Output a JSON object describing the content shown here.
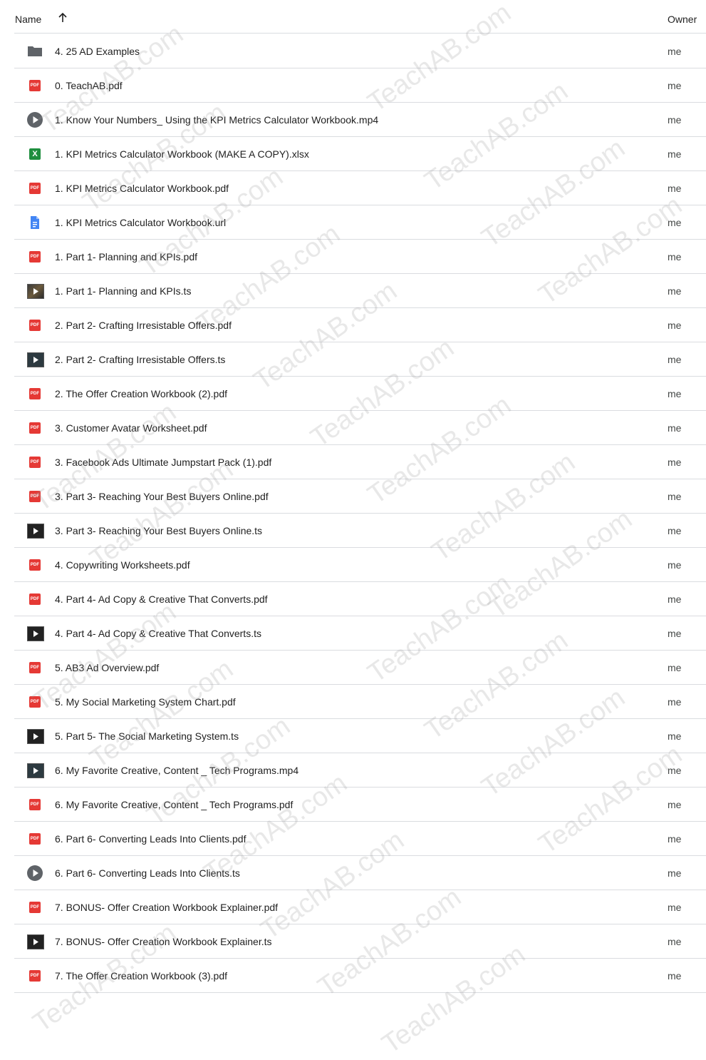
{
  "header": {
    "name_label": "Name",
    "owner_label": "Owner"
  },
  "files": [
    {
      "name": "4. 25 AD Examples",
      "icon": "folder-icon",
      "owner": "me"
    },
    {
      "name": "0. TeachAB.pdf",
      "icon": "pdf-icon",
      "owner": "me"
    },
    {
      "name": "1. Know Your Numbers_ Using the KPI Metrics Calculator Workbook.mp4",
      "icon": "video-icon",
      "owner": "me"
    },
    {
      "name": "1. KPI Metrics Calculator Workbook (MAKE A COPY).xlsx",
      "icon": "spreadsheet-icon",
      "owner": "me"
    },
    {
      "name": "1. KPI Metrics Calculator Workbook.pdf",
      "icon": "pdf-icon",
      "owner": "me"
    },
    {
      "name": "1. KPI Metrics Calculator Workbook.url",
      "icon": "document-icon",
      "owner": "me"
    },
    {
      "name": "1. Part 1- Planning and KPIs.pdf",
      "icon": "pdf-icon",
      "owner": "me"
    },
    {
      "name": "1. Part 1- Planning and KPIs.ts",
      "icon": "video-thumbnail-icon",
      "owner": "me"
    },
    {
      "name": "2. Part 2- Crafting Irresistable Offers.pdf",
      "icon": "pdf-icon",
      "owner": "me"
    },
    {
      "name": "2. Part 2- Crafting Irresistable Offers.ts",
      "icon": "video-thumbnail-icon",
      "owner": "me"
    },
    {
      "name": "2. The Offer Creation Workbook (2).pdf",
      "icon": "pdf-icon",
      "owner": "me"
    },
    {
      "name": "3. Customer Avatar Worksheet.pdf",
      "icon": "pdf-icon",
      "owner": "me"
    },
    {
      "name": "3. Facebook Ads Ultimate Jumpstart Pack (1).pdf",
      "icon": "pdf-icon",
      "owner": "me"
    },
    {
      "name": "3. Part 3- Reaching Your Best Buyers Online.pdf",
      "icon": "pdf-icon",
      "owner": "me"
    },
    {
      "name": "3. Part 3- Reaching Your Best Buyers Online.ts",
      "icon": "video-thumbnail-icon",
      "owner": "me"
    },
    {
      "name": "4. Copywriting Worksheets.pdf",
      "icon": "pdf-icon",
      "owner": "me"
    },
    {
      "name": "4. Part 4- Ad Copy & Creative That Converts.pdf",
      "icon": "pdf-icon",
      "owner": "me"
    },
    {
      "name": "4. Part 4- Ad Copy & Creative That Converts.ts",
      "icon": "video-thumbnail-icon",
      "owner": "me"
    },
    {
      "name": "5. AB3 Ad Overview.pdf",
      "icon": "pdf-icon",
      "owner": "me"
    },
    {
      "name": "5. My Social Marketing System Chart.pdf",
      "icon": "pdf-icon",
      "owner": "me"
    },
    {
      "name": "5. Part 5- The Social Marketing System.ts",
      "icon": "video-thumbnail-icon",
      "owner": "me"
    },
    {
      "name": "6. My Favorite Creative, Content _ Tech Programs.mp4",
      "icon": "video-thumbnail-icon",
      "owner": "me"
    },
    {
      "name": "6. My Favorite Creative, Content _ Tech Programs.pdf",
      "icon": "pdf-icon",
      "owner": "me"
    },
    {
      "name": "6. Part 6- Converting Leads Into Clients.pdf",
      "icon": "pdf-icon",
      "owner": "me"
    },
    {
      "name": "6. Part 6- Converting Leads Into Clients.ts",
      "icon": "video-icon",
      "owner": "me"
    },
    {
      "name": "7. BONUS- Offer Creation Workbook Explainer.pdf",
      "icon": "pdf-icon",
      "owner": "me"
    },
    {
      "name": "7. BONUS- Offer Creation Workbook Explainer.ts",
      "icon": "video-thumbnail-icon",
      "owner": "me"
    },
    {
      "name": "7. The Offer Creation Workbook (3).pdf",
      "icon": "pdf-icon",
      "owner": "me"
    }
  ],
  "watermark_text": "TeachAB.com",
  "colors": {
    "pdf": "#e53935",
    "spreadsheet": "#1e8e3e",
    "document": "#4285f4",
    "folder": "#5f6368",
    "divider": "#dadce0"
  }
}
